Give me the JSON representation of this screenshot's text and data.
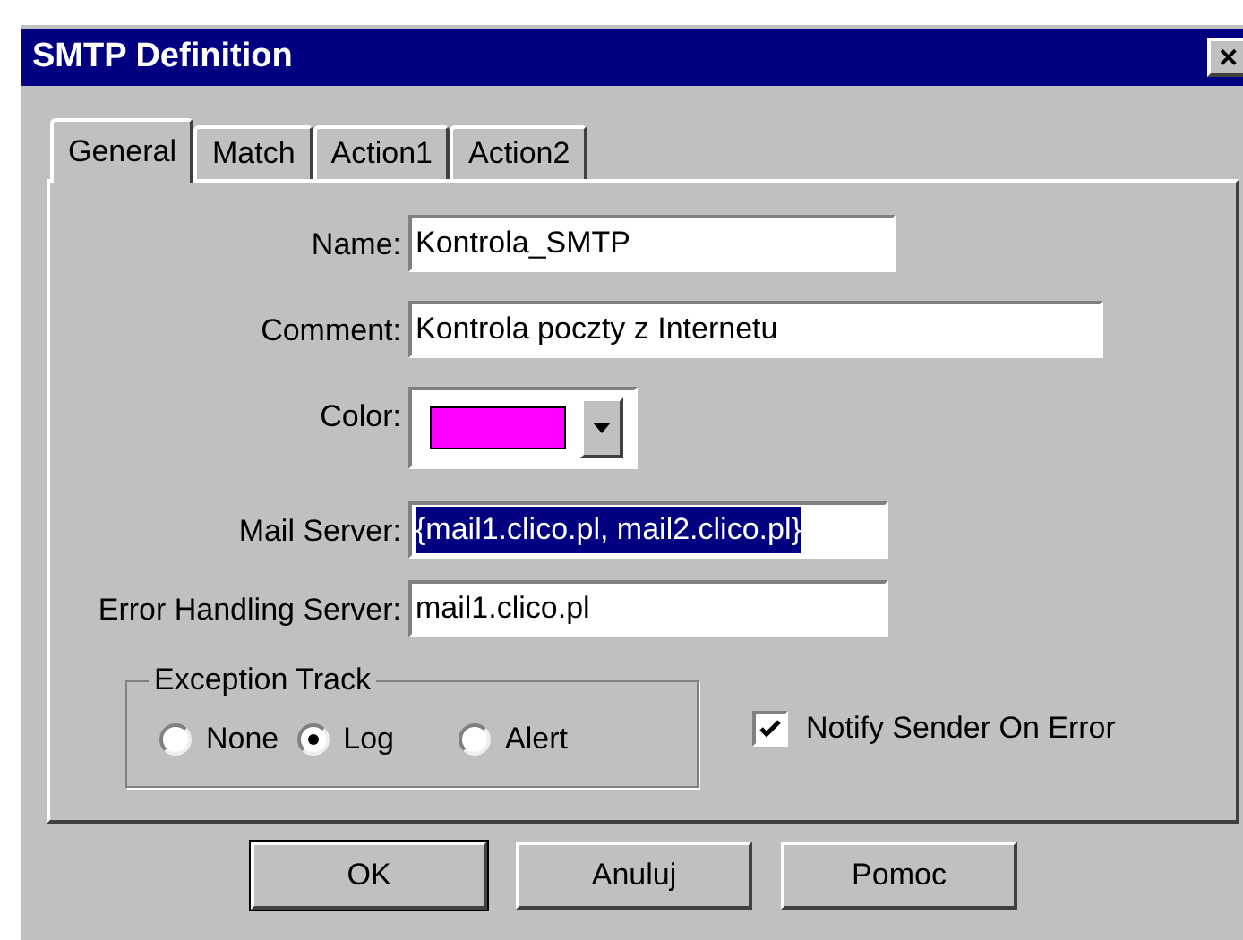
{
  "window": {
    "title": "SMTP Definition",
    "close": "✕"
  },
  "tabs": [
    {
      "label": "General",
      "selected": true
    },
    {
      "label": "Match",
      "selected": false
    },
    {
      "label": "Action1",
      "selected": false
    },
    {
      "label": "Action2",
      "selected": false
    }
  ],
  "fields": [
    {
      "kind": "text",
      "label": "Name:",
      "value": "Kontrola_SMTP",
      "selected": false
    },
    {
      "kind": "text",
      "label": "Comment:",
      "value": "Kontrola poczty z Internetu",
      "selected": false
    },
    {
      "kind": "color",
      "label": "Color:",
      "color": "#ff00ff"
    },
    {
      "kind": "text",
      "label": "Mail Server:",
      "value": "{mail1.clico.pl, mail2.clico.pl}",
      "selected": true
    },
    {
      "kind": "text",
      "label": "Error Handling Server:",
      "value": "mail1.clico.pl",
      "selected": false
    }
  ],
  "exception_track": {
    "title": "Exception Track",
    "options": [
      {
        "label": "None",
        "selected": false
      },
      {
        "label": "Log",
        "selected": true
      },
      {
        "label": "Alert",
        "selected": false
      }
    ]
  },
  "notify": {
    "label": "Notify Sender On Error",
    "checked": true
  },
  "buttons": [
    {
      "label": "OK",
      "default": true
    },
    {
      "label": "Anuluj",
      "default": false
    },
    {
      "label": "Pomoc",
      "default": false
    }
  ]
}
